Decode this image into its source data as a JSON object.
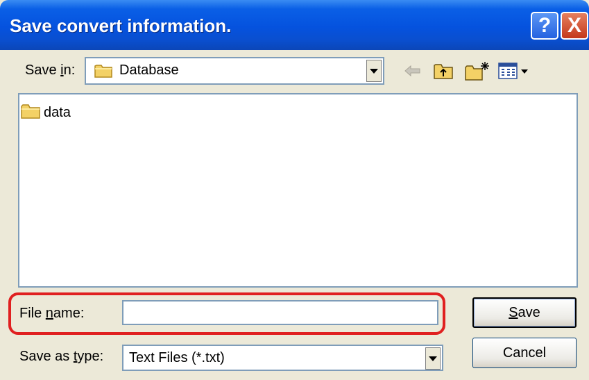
{
  "title": "Save convert information.",
  "title_buttons": {
    "help": "?",
    "close": "X"
  },
  "save_in": {
    "label_prefix": "Save ",
    "label_accel": "i",
    "label_suffix": "n:",
    "value": "Database"
  },
  "toolbar": {
    "icons": [
      "back-arrow-icon",
      "up-one-level-icon",
      "new-folder-icon",
      "view-menu-icon"
    ]
  },
  "files": [
    {
      "name": "data",
      "icon": "folder-icon"
    }
  ],
  "file_name": {
    "label_prefix": "File ",
    "label_accel": "n",
    "label_suffix": "ame:",
    "value": ""
  },
  "save_as_type": {
    "label_prefix": "Save as ",
    "label_accel": "t",
    "label_suffix": "ype:",
    "value": "Text Files (*.txt)"
  },
  "buttons": {
    "save_accel": "S",
    "save_rest": "ave",
    "cancel": "Cancel"
  },
  "colors": {
    "titlebar": "#0552DE",
    "dialog_bg": "#ECE9D8",
    "highlight": "#E02020",
    "field_border": "#7F9DB9"
  }
}
